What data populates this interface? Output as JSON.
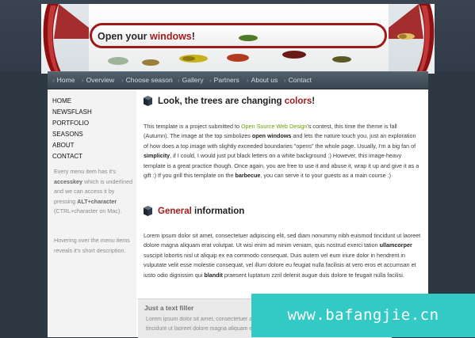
{
  "header": {
    "title_prefix": "Open your ",
    "title_accent": "windows",
    "title_suffix": "!"
  },
  "nav": {
    "items": [
      "Home",
      "Overview",
      "Choose season",
      "Gallery",
      "Partners",
      "About us",
      "Contact"
    ]
  },
  "sidebar": {
    "menu": [
      "HOME",
      "NEWSFLASH",
      "PORTFOLIO",
      "SEASONS",
      "ABOUT",
      "CONTACT"
    ],
    "note1": {
      "t1": "Every menu item has it's",
      "t2": "accesskey",
      "t3": "which is underlined and we can access it by pressing",
      "t4": "ALT+character",
      "t5": "(CTRL+character on Mac)."
    },
    "note2": "Hovering over the menu items reveals it's short description."
  },
  "section1": {
    "heading_prefix": "Look, the trees are changing ",
    "heading_accent": "colors",
    "heading_suffix": "!",
    "p_a": "This template is a project submitted to ",
    "p_link": "Open Source Web Design",
    "p_b": "'s contest, this time the theme is fall (Autumn). The image at the top simbolizes ",
    "p_bold1": "open windows",
    "p_c": " and lets the nature touch you, just an exploration of how does a top image with slightly exceeded boundaries \"opens\" the whole page. Usually, I'm a big fan of ",
    "p_bold2": "simplicity",
    "p_d": ", if I could, I would just put black letters on a white background :) However, this image-heavy template is a great practice though. Once again, you are free to use it and abuse it, wrap it up and give it as a gift :) If you grill this template on the ",
    "p_bold3": "barbecue",
    "p_e": ", you can serve it to your guests as a main course :)"
  },
  "section2": {
    "heading_accent": "General",
    "heading_suffix": " information",
    "p_a": "Lorem ipsum dolor sit amet, consectetuer adipiscing elit, sed diam nonummy nibh euismod tincidunt ut laoreet dolore magna aliquam erat volutpat. Ut wisi enim ad minim veniam, quis nostrud exerci tation ",
    "p_bold1": "ullamcorper",
    "p_b": " suscipit lobortis nisl ut aliquip ex ea commodo consequat. Duis autem vel eum iriure dolor in hendrerit in vulputate velit esse molestie consequat, vel illum dolore eu feugiat nulla facilisis at vero eros et accumsan et iusto odio dignissim qui ",
    "p_bold2": "blandit",
    "p_c": " praesent luptatum zzril delenit augue duis dolore te feugait nulla facilisi."
  },
  "filler": {
    "title": "Just a text filler",
    "text": "Lorem ipsum dolor sit amet, consectetuer adipiscing elit, sed diam nonummy nibh euismod tincidunt ut laoreet dolore magna aliquam erat volutpat."
  },
  "watermark": "www.bafangjie.cn",
  "colors": {
    "accent_red": "#a51c1c",
    "link_green": "#6b9b00",
    "page_bg": "#2e3843",
    "watermark_bg": "#33c9c4"
  }
}
